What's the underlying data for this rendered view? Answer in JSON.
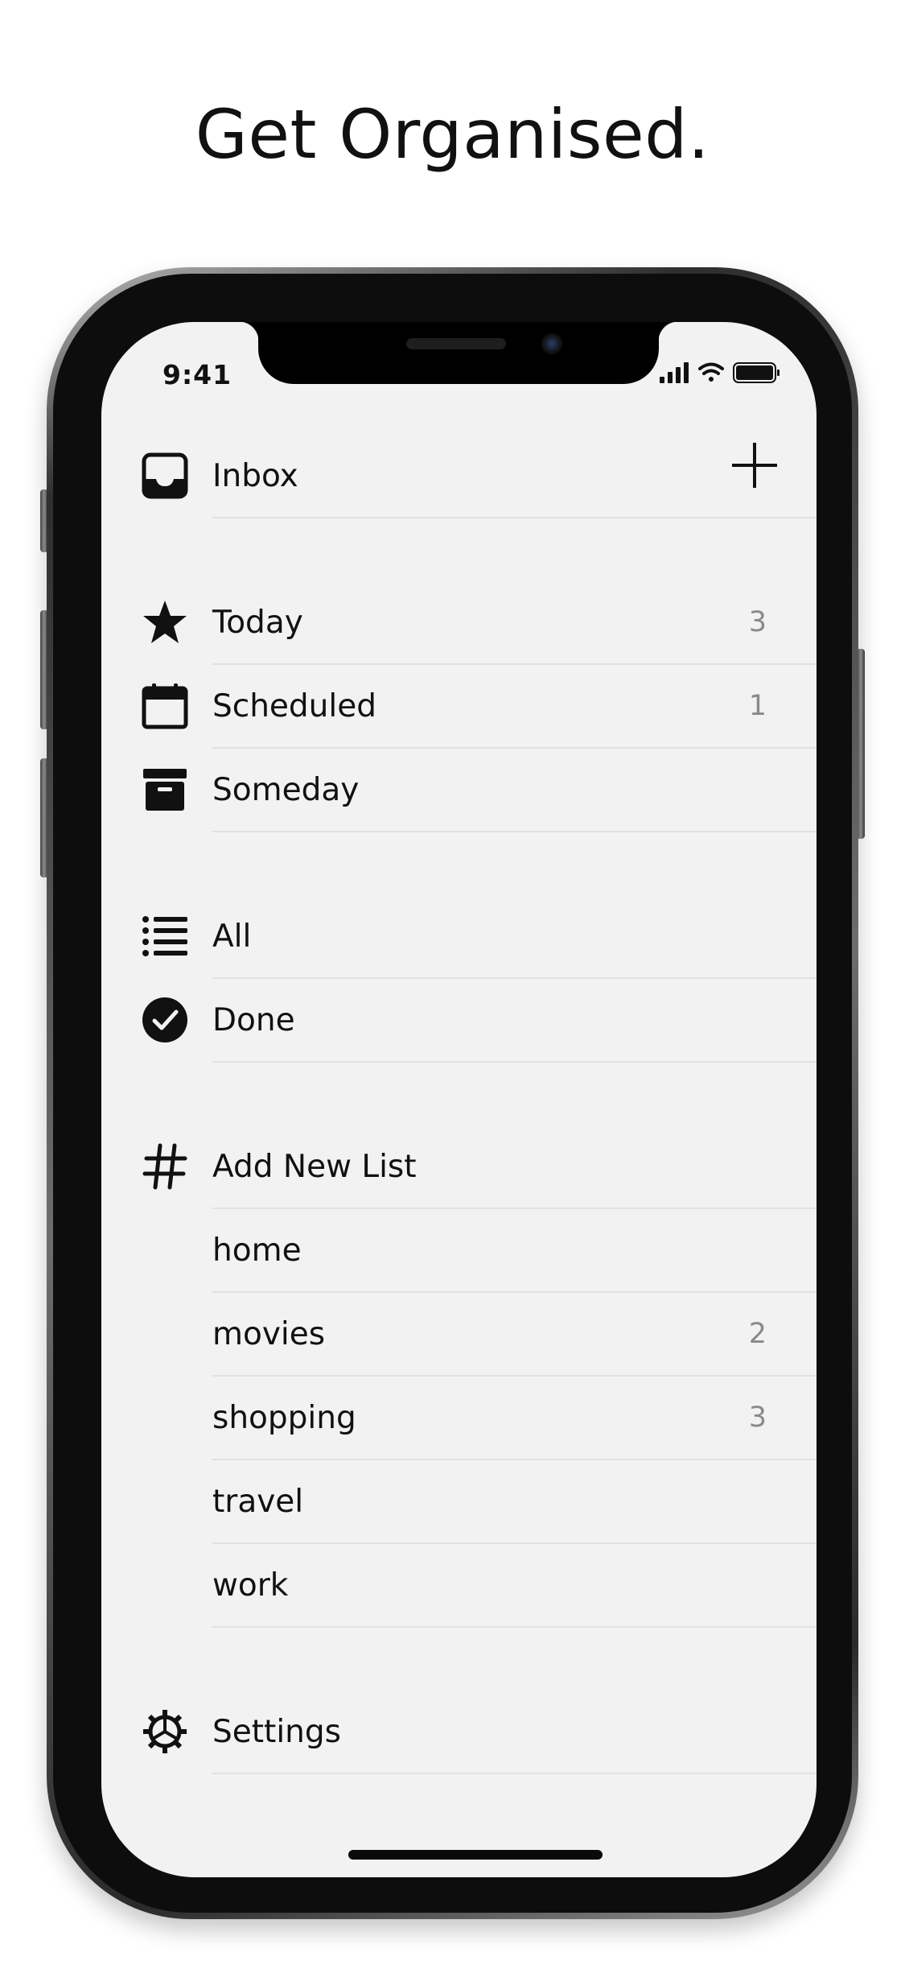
{
  "headline": "Get Organised.",
  "status_bar": {
    "time": "9:41"
  },
  "toolbar": {
    "add_icon": "plus-icon"
  },
  "groups": [
    {
      "items": [
        {
          "label": "Inbox",
          "count": "",
          "icon": "inbox-icon"
        }
      ]
    },
    {
      "items": [
        {
          "label": "Today",
          "count": "3",
          "icon": "star-icon"
        },
        {
          "label": "Scheduled",
          "count": "1",
          "icon": "calendar-icon"
        },
        {
          "label": "Someday",
          "count": "",
          "icon": "archive-box-icon"
        }
      ]
    },
    {
      "items": [
        {
          "label": "All",
          "count": "",
          "icon": "list-icon"
        },
        {
          "label": "Done",
          "count": "",
          "icon": "checkmark-circle-icon"
        }
      ]
    },
    {
      "items": [
        {
          "label": "Add New List",
          "count": "",
          "icon": "hashtag-icon"
        },
        {
          "label": "home",
          "count": ""
        },
        {
          "label": "movies",
          "count": "2"
        },
        {
          "label": "shopping",
          "count": "3"
        },
        {
          "label": "travel",
          "count": ""
        },
        {
          "label": "work",
          "count": ""
        }
      ]
    },
    {
      "items": [
        {
          "label": "Settings",
          "count": "",
          "icon": "gear-icon"
        }
      ]
    }
  ],
  "colors": {
    "background": "#f2f2f2",
    "text": "#111111",
    "count": "#8a8a8a",
    "separator": "#e1e1e1"
  }
}
